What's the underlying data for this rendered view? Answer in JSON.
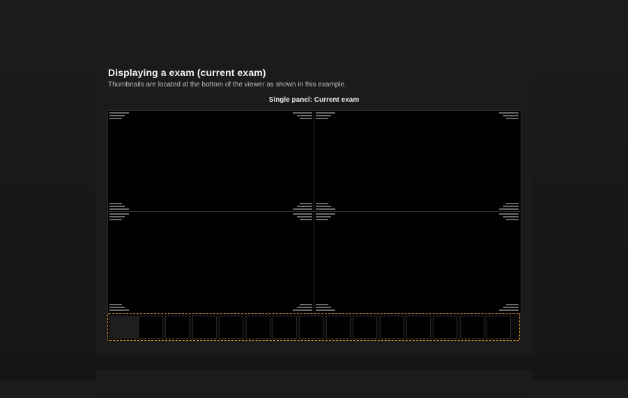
{
  "section": {
    "title": "Displaying a exam (current exam)",
    "subtitle": "Thumbnails are located at the bottom of the viewer as shown in this example.",
    "panel_label": "Single panel: Current exam"
  },
  "viewer": {
    "layout": "2x2",
    "viewports": [
      "top-left",
      "top-right",
      "bottom-left",
      "bottom-right"
    ]
  },
  "thumbnails": {
    "count": 15,
    "highlight_color": "#d4922c"
  },
  "colors": {
    "background": "#171717",
    "card": "#1b1b1b",
    "viewport": "#000000",
    "overlay_text": "#6a6a6a"
  }
}
